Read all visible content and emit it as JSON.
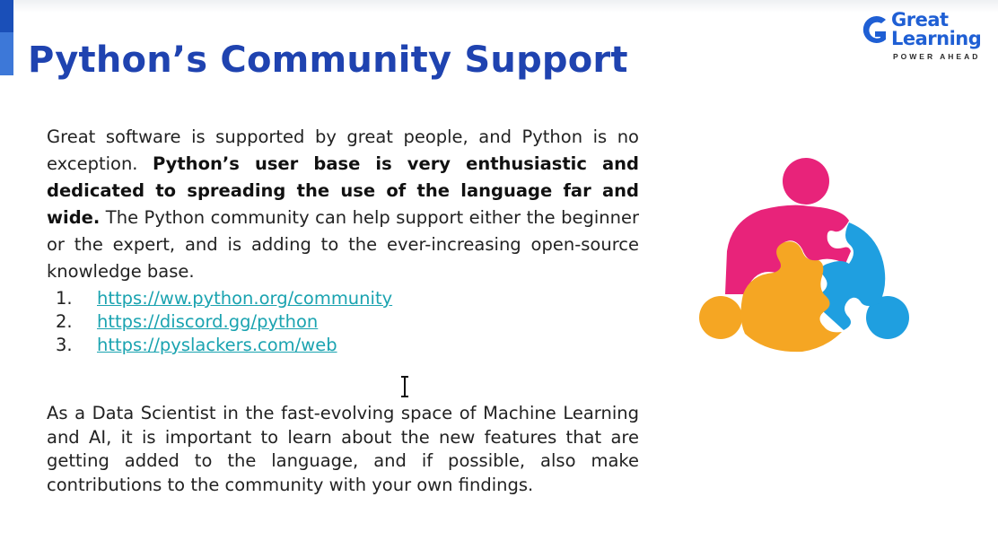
{
  "slide": {
    "title": "Python’s Community Support",
    "para1": {
      "lead": "Great software is supported by great people, and Python is no exception.",
      "bold": "Python’s user base is very enthusiastic and dedicated to spreading the use of the language far and wide.",
      "tail": "The Python community can help support either the beginner or the expert, and is adding to the ever-increasing open-source knowledge base."
    },
    "links": [
      {
        "num": "1.",
        "text": "https://ww.python.org/community"
      },
      {
        "num": "2.",
        "text": "https://discord.gg/python"
      },
      {
        "num": "3.",
        "text": "https://pyslackers.com/web"
      }
    ],
    "para2": "As a Data Scientist in the fast-evolving space of Machine Learning and AI, it is important to learn about the new features that are getting added to the language, and if possible, also make contributions to the community with your own findings."
  },
  "logo": {
    "line1": "Great",
    "line2": "Learning",
    "tagline": "POWER AHEAD"
  },
  "colors": {
    "title": "#1f43b0",
    "link": "#1aa3b0",
    "puzzle_pink": "#e8237a",
    "puzzle_blue": "#1f9fe0",
    "puzzle_orange": "#f5a623"
  },
  "icons": [
    "text-cursor-icon",
    "puzzle-community-icon",
    "great-learning-logo"
  ]
}
